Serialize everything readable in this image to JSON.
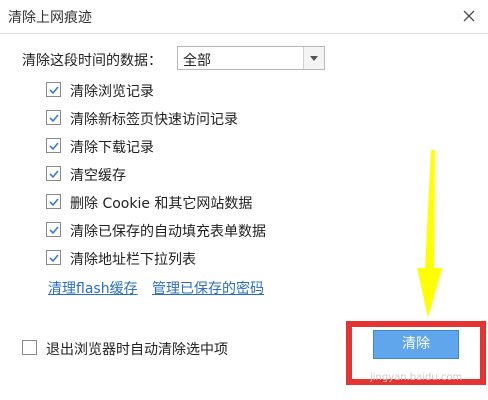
{
  "dialog": {
    "title": "清除上网痕迹",
    "close_icon": "close-icon"
  },
  "range": {
    "label": "清除这段时间的数据：",
    "selected": "全部"
  },
  "options": [
    {
      "label": "清除浏览记录",
      "checked": true
    },
    {
      "label": "清除新标签页快速访问记录",
      "checked": true
    },
    {
      "label": "清除下载记录",
      "checked": true
    },
    {
      "label": "清空缓存",
      "checked": true
    },
    {
      "label": "删除 Cookie 和其它网站数据",
      "checked": true
    },
    {
      "label": "清除已保存的自动填充表单数据",
      "checked": true
    },
    {
      "label": "清除地址栏下拉列表",
      "checked": true
    }
  ],
  "links": {
    "flash": "清理flash缓存",
    "passwords": "管理已保存的密码"
  },
  "auto_clear": {
    "label": "退出浏览器时自动清除选中项",
    "checked": false
  },
  "clear_button": {
    "label": "清除"
  },
  "colors": {
    "accent": "#5fa6ec",
    "link": "#2a6fc2",
    "highlight": "#e53232",
    "arrow": "#ffff00"
  },
  "watermark": "jingyan.baidu.com"
}
